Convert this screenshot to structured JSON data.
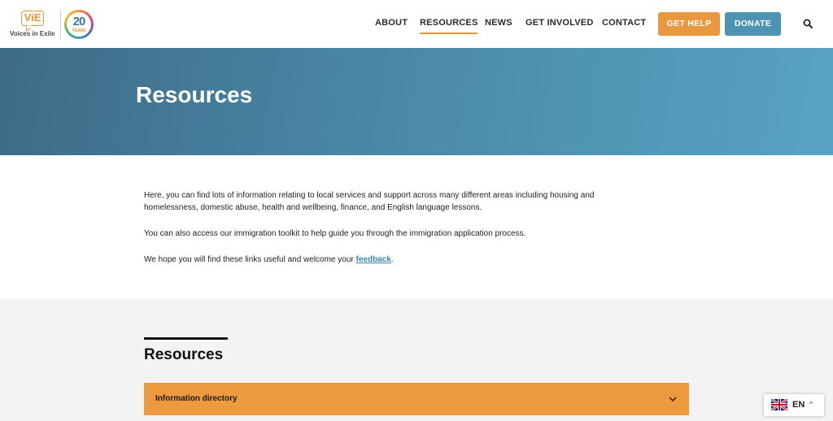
{
  "header": {
    "logo_text": "ViE",
    "logo_subtitle": "Voices in Exile",
    "anniversary_number": "20",
    "anniversary_label": "YEARS",
    "nav": {
      "about": "ABOUT",
      "resources": "RESOURCES",
      "news": "NEWS",
      "get_involved": "GET INVOLVED",
      "contact": "CONTACT"
    },
    "active_nav": "resources",
    "get_help_label": "GET HELP",
    "donate_label": "DONATE",
    "search_icon": "search-icon"
  },
  "hero": {
    "title": "Resources"
  },
  "intro": {
    "paragraph_1": "Here, you can find lots of information relating to local services and support across many different areas including housing and homelessness, domestic abuse, health and wellbeing, finance, and English language lessons.",
    "paragraph_2": "You can also access our immigration toolkit to help guide you through the immigration application process.",
    "paragraph_3_prefix": "We hope you will find these links useful and welcome your ",
    "paragraph_3_link": "feedback",
    "paragraph_3_suffix": "."
  },
  "resources_section": {
    "heading": "Resources",
    "accordion_items": [
      {
        "label": "Information directory",
        "icon": "chevron-down-icon"
      }
    ]
  },
  "language": {
    "code": "EN",
    "flag_icon": "uk-flag-icon",
    "caret": "^"
  },
  "colors": {
    "accent_orange": "#ea9840",
    "accent_blue": "#4f93b3",
    "hero_gradient_start": "#3d6b86",
    "hero_gradient_end": "#58a3c3",
    "link_color": "#3a85a8"
  }
}
